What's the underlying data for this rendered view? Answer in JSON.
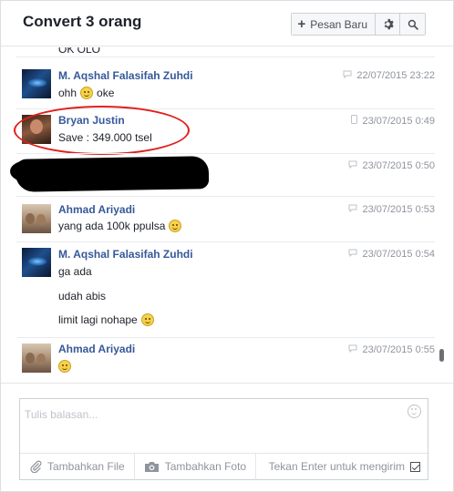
{
  "header": {
    "title": "Convert 3 orang",
    "new_message_label": "Pesan Baru"
  },
  "messages": {
    "truncated_text": "OK OLO",
    "items": [
      {
        "sender": "M. Aqshal Falasifah Zuhdi",
        "time": "22/07/2015 23:22",
        "lines": [
          "ohh",
          "oke"
        ],
        "source": "chat"
      },
      {
        "sender": "Bryan Justin",
        "time": "23/07/2015 0:49",
        "lines": [
          "Save : 349.000 tsel"
        ],
        "source": "mobile"
      },
      {
        "sender": "",
        "time": "23/07/2015 0:50",
        "lines": [],
        "source": "chat"
      },
      {
        "sender": "Ahmad Ariyadi",
        "time": "23/07/2015 0:53",
        "lines": [
          "yang ada 100k ppulsa"
        ],
        "source": "chat"
      },
      {
        "sender": "M. Aqshal Falasifah Zuhdi",
        "time": "23/07/2015 0:54",
        "lines": [
          "ga ada",
          "udah abis",
          "limit lagi nohape"
        ],
        "source": "chat"
      },
      {
        "sender": "Ahmad Ariyadi",
        "time": "23/07/2015 0:55",
        "lines": [],
        "source": "chat"
      }
    ]
  },
  "composer": {
    "placeholder": "Tulis balasan...",
    "add_file_label": "Tambahkan File",
    "add_photo_label": "Tambahkan Foto",
    "enter_to_send_label": "Tekan Enter untuk mengirim",
    "enter_to_send_checked": true
  },
  "colors": {
    "sender_link": "#365899",
    "highlight_annotation": "#e0201a"
  }
}
